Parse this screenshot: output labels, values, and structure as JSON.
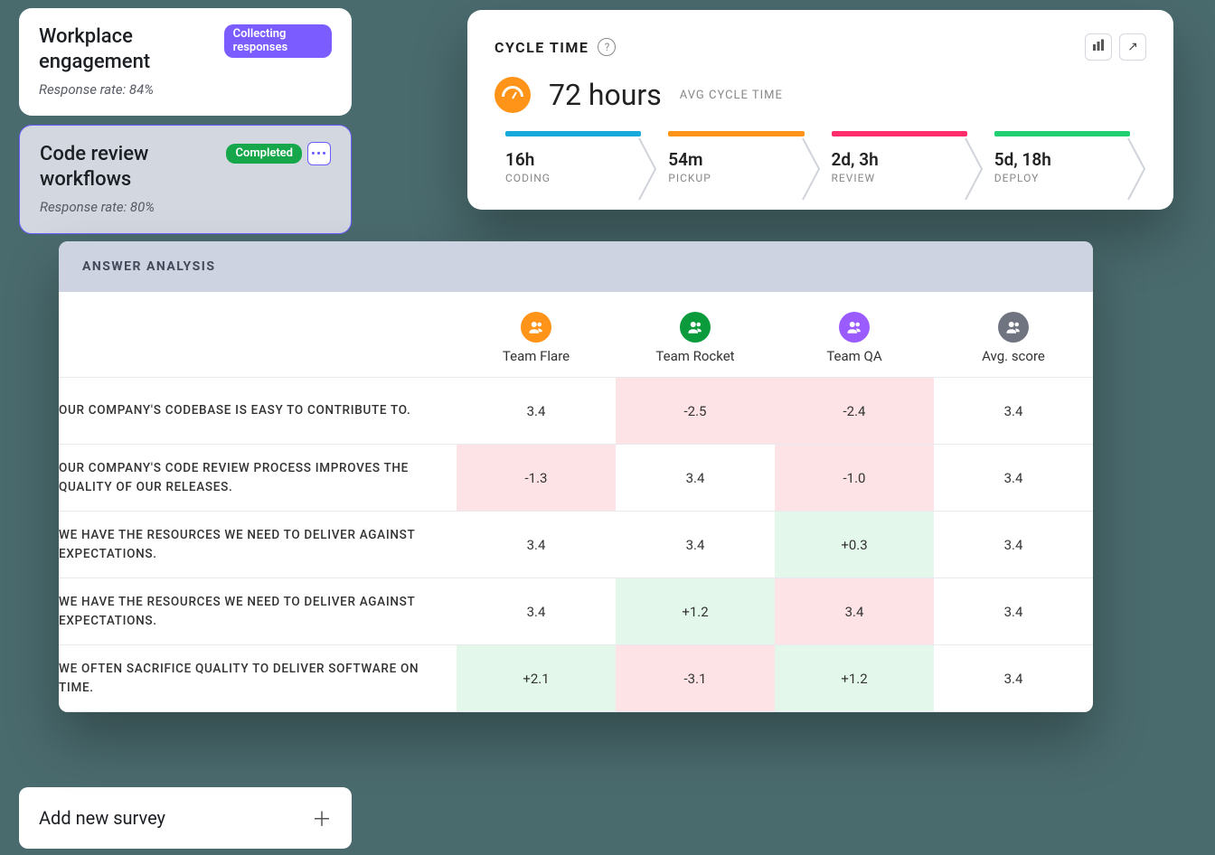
{
  "surveys": [
    {
      "title": "Workplace engagement",
      "response_label": "Response rate: 84%",
      "status": "Collecting responses",
      "status_style": "purple"
    },
    {
      "title": "Code review workflows",
      "response_label": "Response rate: 80%",
      "status": "Completed",
      "status_style": "green"
    }
  ],
  "add_survey_label": "Add new survey",
  "cycle": {
    "title": "CYCLE TIME",
    "big_value": "72 hours",
    "big_sub": "AVG CYCLE TIME",
    "stages": [
      {
        "value": "16h",
        "label": "CODING",
        "color": "blue"
      },
      {
        "value": "54m",
        "label": "PICKUP",
        "color": "orange"
      },
      {
        "value": "2d, 3h",
        "label": "REVIEW",
        "color": "pink"
      },
      {
        "value": "5d, 18h",
        "label": "DEPLOY",
        "color": "green"
      }
    ]
  },
  "analysis": {
    "title": "ANSWER ANALYSIS",
    "columns": [
      {
        "name": "Team Flare",
        "color": "orange"
      },
      {
        "name": "Team Rocket",
        "color": "green"
      },
      {
        "name": "Team QA",
        "color": "purple"
      },
      {
        "name": "Avg. score",
        "color": "grey"
      }
    ],
    "rows": [
      {
        "q": "OUR COMPANY'S CODEBASE IS EASY TO CONTRIBUTE TO.",
        "cells": [
          {
            "v": "3.4"
          },
          {
            "v": "-2.5",
            "c": "red"
          },
          {
            "v": "-2.4",
            "c": "red"
          },
          {
            "v": "3.4"
          }
        ]
      },
      {
        "q": "OUR COMPANY'S CODE REVIEW PROCESS IMPROVES THE QUALITY OF OUR RELEASES.",
        "cells": [
          {
            "v": "-1.3",
            "c": "red"
          },
          {
            "v": "3.4"
          },
          {
            "v": "-1.0",
            "c": "red"
          },
          {
            "v": "3.4"
          }
        ]
      },
      {
        "q": "WE HAVE THE RESOURCES WE NEED TO DELIVER AGAINST EXPECTATIONS.",
        "cells": [
          {
            "v": "3.4"
          },
          {
            "v": "3.4"
          },
          {
            "v": "+0.3",
            "c": "grn"
          },
          {
            "v": "3.4"
          }
        ]
      },
      {
        "q": "WE HAVE THE RESOURCES WE NEED TO DELIVER AGAINST EXPECTATIONS.",
        "cells": [
          {
            "v": "3.4"
          },
          {
            "v": "+1.2",
            "c": "grn"
          },
          {
            "v": "3.4",
            "c": "red"
          },
          {
            "v": "3.4"
          }
        ]
      },
      {
        "q": "WE OFTEN SACRIFICE QUALITY TO DELIVER SOFTWARE ON TIME.",
        "cells": [
          {
            "v": "+2.1",
            "c": "grn"
          },
          {
            "v": "-3.1",
            "c": "red"
          },
          {
            "v": "+1.2",
            "c": "grn"
          },
          {
            "v": "3.4"
          }
        ]
      }
    ]
  }
}
